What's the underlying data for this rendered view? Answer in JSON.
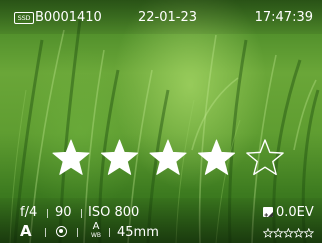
{
  "header": {
    "media_icon": "ssd-icon",
    "media_label": "SSD",
    "file_id": "B0001410",
    "date": "22-01-23",
    "time": "17:47:39"
  },
  "rating": {
    "value": 4,
    "max": 5,
    "star_icon": "star-icon"
  },
  "exposure": {
    "aperture": "f/4",
    "shutter": "90",
    "iso": "ISO 800",
    "ev_icon": "exposure-compensation-icon",
    "ev": "0.0EV"
  },
  "status": {
    "mode": "A",
    "metering_icon": "metering-icon",
    "wb_icon": "white-balance-auto-icon",
    "wb_auto_label": "A",
    "wb_label": "WB",
    "focal_length": "45mm",
    "mini_rating_icon": "rating-stars-icon"
  },
  "colors": {
    "text": "#ffffff",
    "background_tint": "#5f9d31"
  }
}
